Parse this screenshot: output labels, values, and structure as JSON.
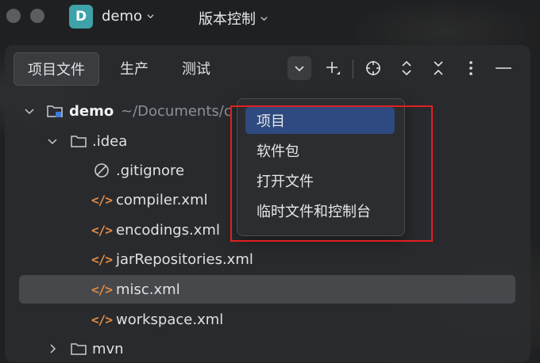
{
  "titlebar": {
    "project_badge": "D",
    "project_name": "demo",
    "vcs_label": "版本控制"
  },
  "toolbar": {
    "tabs": [
      {
        "label": "项目文件",
        "active": true
      },
      {
        "label": "生产",
        "active": false
      },
      {
        "label": "测试",
        "active": false
      }
    ],
    "icons": [
      "chevron-down-icon",
      "add-icon",
      "locate-icon",
      "expand-all-icon",
      "collapse-all-icon",
      "more-icon",
      "minimize-icon"
    ]
  },
  "tree": {
    "root": {
      "name": "demo",
      "path": "~/Documents/c"
    },
    "items": [
      {
        "name": ".idea",
        "type": "folder"
      },
      {
        "name": ".gitignore",
        "type": "ignore"
      },
      {
        "name": "compiler.xml",
        "type": "xml"
      },
      {
        "name": "encodings.xml",
        "type": "xml"
      },
      {
        "name": "jarRepositories.xml",
        "type": "xml"
      },
      {
        "name": "misc.xml",
        "type": "xml",
        "selected": true
      },
      {
        "name": "workspace.xml",
        "type": "xml"
      },
      {
        "name": "mvn",
        "type": "folder"
      }
    ]
  },
  "popup": {
    "items": [
      {
        "label": "项目",
        "active": true
      },
      {
        "label": "软件包",
        "active": false
      },
      {
        "label": "打开文件",
        "active": false
      },
      {
        "label": "临时文件和控制台",
        "active": false
      }
    ]
  },
  "colors": {
    "accent": "#2e4a80",
    "badge": "#3ea2a8",
    "xml_icon": "#e08b45",
    "highlight_box": "#e02020"
  }
}
